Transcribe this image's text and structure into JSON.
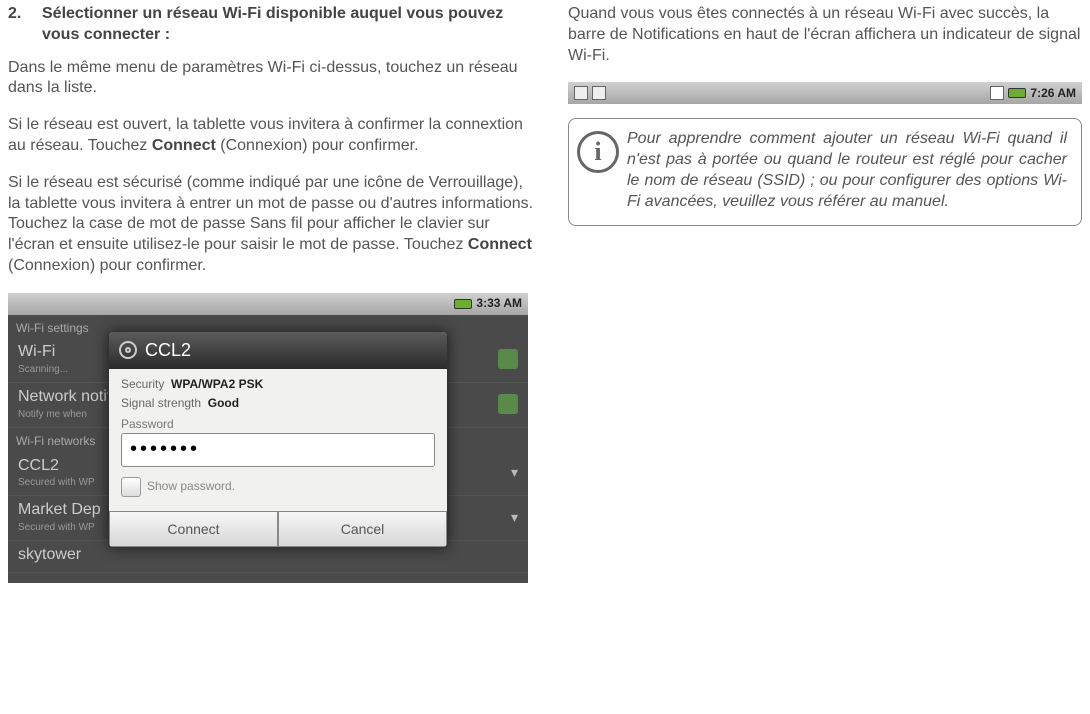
{
  "left": {
    "step_num": "2.",
    "step_title": "Sélectionner un réseau Wi-Fi disponible auquel vous pouvez vous connecter :",
    "para1": "Dans le même menu de paramètres Wi-Fi ci-dessus, touchez un réseau dans la liste.",
    "para2_a": "Si le réseau est ouvert, la tablette vous invitera à confirmer la connextion au réseau. Touchez ",
    "para2_bold": "Connect",
    "para2_b": " (Connexion) pour confirmer.",
    "para3_a": "Si le réseau est sécurisé (comme indiqué par une icône de Verrouillage), la tablette vous invitera à entrer un mot de passe ou d'autres informations.  Touchez la case de mot de passe Sans fil pour afficher le clavier sur l'écran et ensuite utilisez-le pour saisir le mot de passe. Touchez ",
    "para3_bold": "Connect",
    "para3_b": " (Connexion) pour confirmer."
  },
  "shot1": {
    "time": "3:33 AM",
    "settings_title": "Wi-Fi settings",
    "row_wifi_name": "Wi-Fi",
    "row_wifi_sub": "Scanning...",
    "row_notify_name": "Network notification",
    "row_notify_sub": "Notify me when",
    "section_networks": "Wi-Fi networks",
    "row_ccl2": "CCL2",
    "row_ccl2_sub": "Secured with WP",
    "row_market": "Market Dep",
    "row_market_sub": "Secured with WP",
    "row_sky": "skytower",
    "dialog": {
      "title": "CCL2",
      "security_label": "Security",
      "security_value": "WPA/WPA2 PSK",
      "signal_label": "Signal strength",
      "signal_value": "Good",
      "password_label": "Password",
      "password_value": "•••••••",
      "show_password": "Show password.",
      "connect": "Connect",
      "cancel": "Cancel"
    }
  },
  "right": {
    "para": "Quand vous vous êtes connectés à un réseau Wi-Fi avec succès, la barre de Notifications en haut de l'écran affichera un indicateur de signal Wi-Fi.",
    "time": "7:26 AM",
    "info": "Pour apprendre comment ajouter un réseau Wi-Fi quand il n'est pas à portée ou quand le routeur est réglé pour cacher le nom de réseau (SSID) ; ou pour configurer des options Wi-Fi avancées, veuillez vous référer au manuel."
  }
}
